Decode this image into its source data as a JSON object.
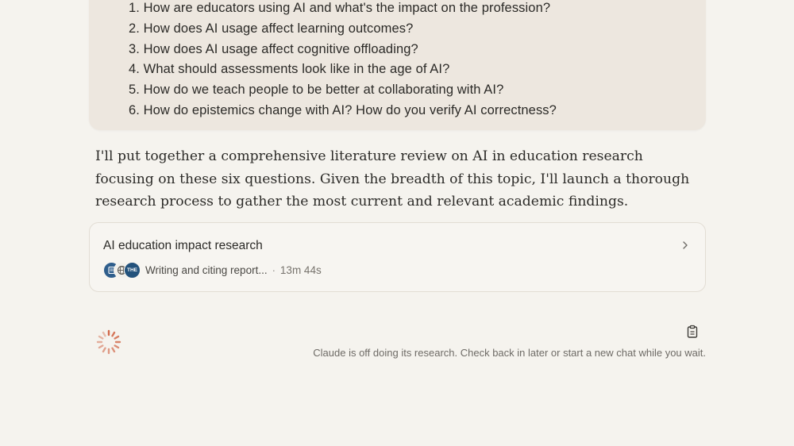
{
  "user_message": {
    "questions": [
      "1. How are educators using AI and what's the impact on the profession?",
      "2. How does AI usage affect learning outcomes?",
      "3. How does AI usage affect cognitive offloading?",
      "4. What should assessments look like in the age of AI?",
      "5. How do we teach people to be better at collaborating with AI?",
      "6. How do epistemics change with AI? How do you verify AI correctness?"
    ]
  },
  "assistant": {
    "response_text": "I'll put together a comprehensive literature review on AI in education research focusing on these six questions. Given the breadth of this topic, I'll launch a thorough research process to gather the most current and relevant academic findings."
  },
  "research_card": {
    "title": "AI education impact research",
    "status": "Writing and citing report...",
    "separator": "·",
    "elapsed": "13m 44s",
    "sources": [
      {
        "icon": "journal-source-icon",
        "color": "#2f5e8c"
      },
      {
        "icon": "globe-icon",
        "color": "#f3f1ec"
      },
      {
        "icon": "the-source-icon",
        "label": "THE",
        "color": "#23527c"
      }
    ],
    "chevron": "chevron-right-icon"
  },
  "footer": {
    "note": "Claude is off doing its research. Check back in later or start a new chat while you wait.",
    "spinner_color": "#d2694a"
  }
}
